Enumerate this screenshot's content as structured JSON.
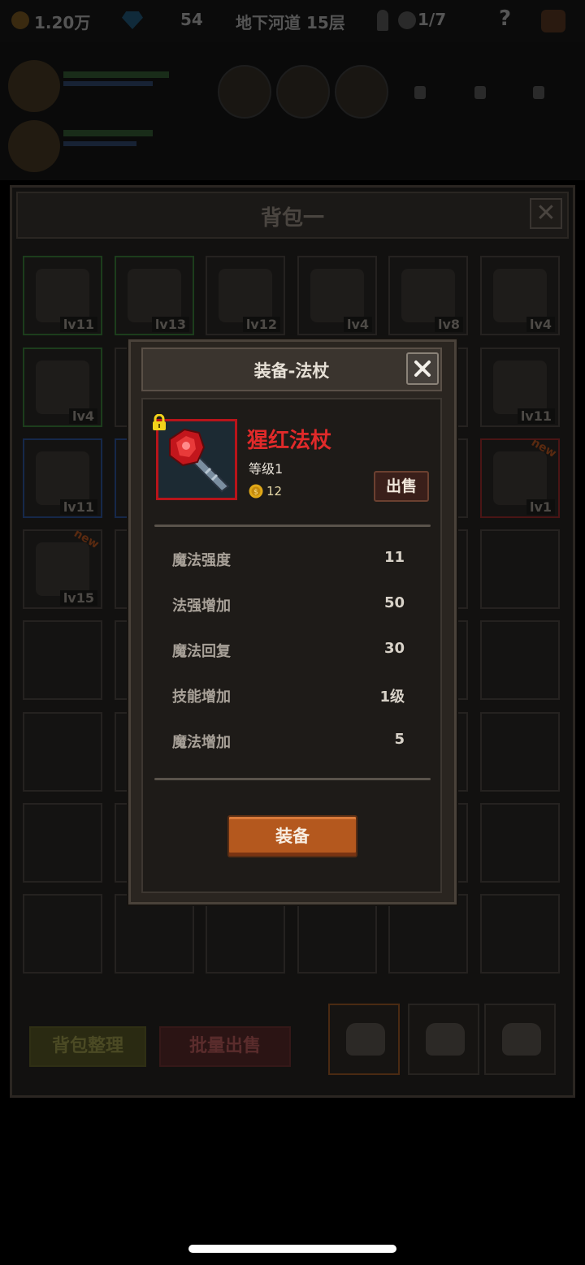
{
  "topbar": {
    "gold": "1.20万",
    "gems": "54",
    "location": "地下河道 15层",
    "keys": "1/7",
    "help": "?"
  },
  "bag": {
    "title": "背包一",
    "close": "✕",
    "slots": [
      {
        "level": "lv11",
        "border": "green"
      },
      {
        "level": "lv13",
        "border": "green"
      },
      {
        "level": "lv12",
        "border": "none"
      },
      {
        "level": "lv4",
        "border": "none"
      },
      {
        "level": "lv8",
        "border": "none"
      },
      {
        "level": "lv4",
        "border": "none"
      },
      {
        "level": "lv4",
        "border": "green"
      },
      {
        "level": "",
        "border": "none"
      },
      {
        "level": "",
        "border": "none"
      },
      {
        "level": "",
        "border": "none"
      },
      {
        "level": "",
        "border": "none"
      },
      {
        "level": "lv11",
        "border": "none"
      },
      {
        "level": "lv11",
        "border": "blue"
      },
      {
        "level": "",
        "border": "blue"
      },
      {
        "level": "",
        "border": "none"
      },
      {
        "level": "",
        "border": "none"
      },
      {
        "level": "",
        "border": "none"
      },
      {
        "level": "lv1",
        "border": "red",
        "new": "new"
      },
      {
        "level": "lv15",
        "border": "none",
        "new": "new"
      }
    ],
    "sort_button": "背包整理",
    "batch_sell_button": "批量出售"
  },
  "modal": {
    "title": "装备-法杖",
    "item_name": "猩红法杖",
    "item_level": "等级1",
    "price": "12",
    "sell_button": "出售",
    "stats": [
      {
        "label": "魔法强度",
        "value": "11"
      },
      {
        "label": "法强增加",
        "value": "50"
      },
      {
        "label": "魔法回复",
        "value": "30"
      },
      {
        "label": "技能增加",
        "value": "1级"
      },
      {
        "label": "魔法增加",
        "value": "5"
      }
    ],
    "equip_button": "装备"
  },
  "colors": {
    "item_name": "#e02a2a",
    "equip_button": "#b4581e",
    "rarity_frame": "#b8141a"
  }
}
